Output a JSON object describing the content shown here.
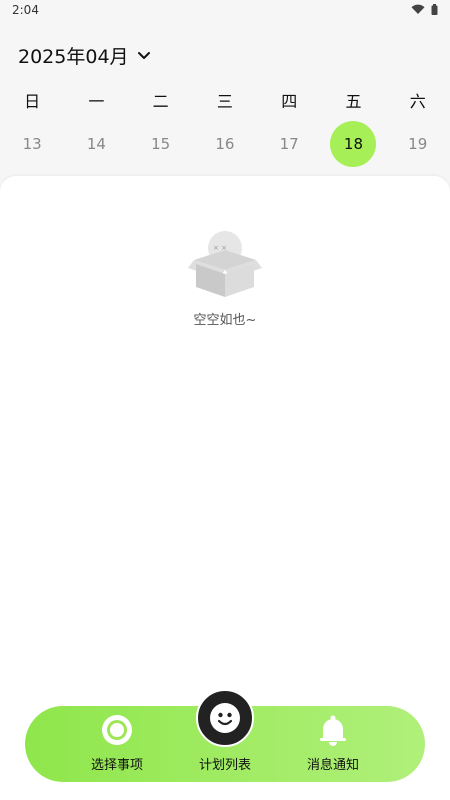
{
  "status_bar": {
    "time": "2:04",
    "icons": [
      "wifi-icon",
      "battery-icon"
    ]
  },
  "calendar": {
    "month_label": "2025年04月",
    "weekdays": [
      "日",
      "一",
      "二",
      "三",
      "四",
      "五",
      "六"
    ],
    "dates": [
      "13",
      "14",
      "15",
      "16",
      "17",
      "18",
      "19"
    ],
    "selected_date": "18",
    "accent_color": "#a6ef56"
  },
  "empty_state": {
    "text": "空空如也~",
    "icon": "empty-box-icon"
  },
  "bottom_nav": {
    "items": [
      {
        "label": "选择事项",
        "icon": "target-circle-icon"
      },
      {
        "label": "计划列表",
        "icon": "smiley-face-icon"
      },
      {
        "label": "消息通知",
        "icon": "bell-icon"
      }
    ],
    "gradient": [
      "#8fe64b",
      "#b0f07a"
    ]
  }
}
